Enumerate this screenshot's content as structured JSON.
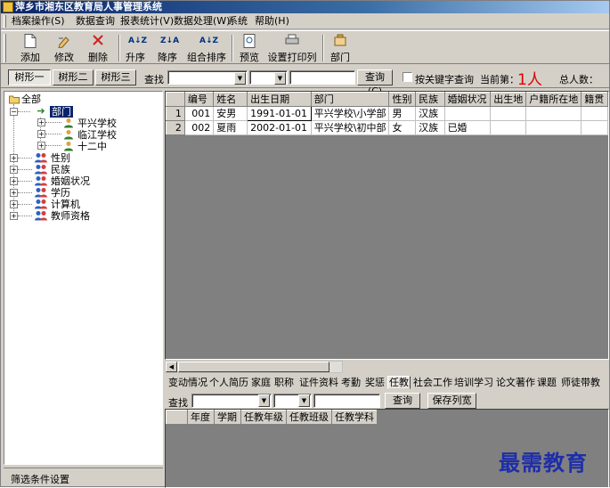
{
  "window": {
    "title": "萍乡市湘东区教育局人事管理系统"
  },
  "menu": [
    "档案操作(S)",
    "数据查询",
    "报表统计(V)",
    "数据处理(W)",
    "系统",
    "帮助(H)"
  ],
  "toolbar": {
    "add": "添加",
    "edit": "修改",
    "delete": "删除",
    "asc": "升序",
    "desc": "降序",
    "multisort": "组合排序",
    "preview": "预览",
    "print_setup": "设置打印列",
    "dept": "部门"
  },
  "search": {
    "tree_tabs": [
      "树形一",
      "树形二",
      "树形三"
    ],
    "find_label": "查找",
    "query_button": "查询(C)",
    "keyword_checkbox": "按关键字查询",
    "current_label": "当前第：",
    "current_value": "1人",
    "total_label": "总人数："
  },
  "tree": {
    "root": "全部",
    "dept": "部门",
    "schools": [
      "平兴学校",
      "临江学校",
      "十二中"
    ],
    "categories": [
      "性别",
      "民族",
      "婚姻状况",
      "学历",
      "计算机",
      "教师资格"
    ]
  },
  "filter_title": "筛选条件设置",
  "grid": {
    "columns": [
      "",
      "编号",
      "姓名",
      "出生日期",
      "部门",
      "性别",
      "民族",
      "婚姻状况",
      "出生地",
      "户籍所在地",
      "籍贯"
    ],
    "rows": [
      [
        "1",
        "001",
        "安男",
        "1991-01-01",
        "平兴学校\\小学部",
        "男",
        "汉族",
        "",
        "",
        "",
        ""
      ],
      [
        "2",
        "002",
        "夏雨",
        "2002-01-01",
        "平兴学校\\初中部",
        "女",
        "汉族",
        "已婚",
        "",
        "",
        ""
      ]
    ]
  },
  "detail_tabs": [
    "变动情况",
    "个人简历",
    "家庭",
    "职称",
    "证件资料",
    "考勤",
    "奖惩",
    "任教",
    "社会工作",
    "培训学习",
    "论文著作",
    "课题",
    "师徒带教"
  ],
  "detail_active": "任教",
  "detail_search": {
    "find_label": "查找",
    "query_button": "查询",
    "save_button": "保存列宽"
  },
  "detail_grid": {
    "columns": [
      "",
      "年度",
      "学期",
      "任教年级",
      "任教班级",
      "任教学科"
    ]
  },
  "watermark": "最需教育"
}
